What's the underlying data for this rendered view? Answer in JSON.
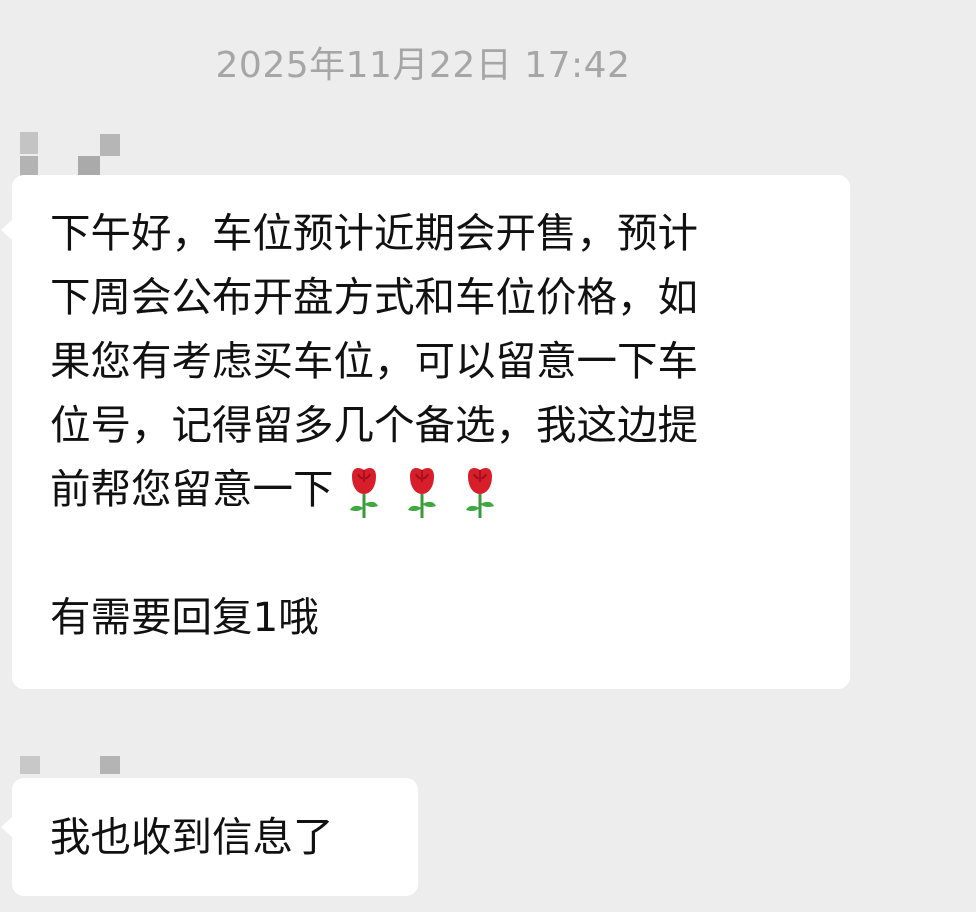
{
  "chat": {
    "timestamp": "2025年11月22日 17:42",
    "messages": [
      {
        "lines": [
          "下午好，车位预计近期会开售，预计",
          "下周会公布开盘方式和车位价格，如",
          "果您有考虑买车位，可以留意一下车",
          "位号，记得留多几个备选，我这边提",
          "前帮您留意一下"
        ],
        "emoji_icons": [
          "rose-icon",
          "rose-icon",
          "rose-icon"
        ],
        "followup": "有需要回复1哦"
      },
      {
        "text": "我也收到信息了"
      }
    ]
  },
  "colors": {
    "background": "#ededed",
    "bubble": "#ffffff",
    "text": "#111111",
    "timestamp": "#a6a6a6",
    "rose_petal": "#d81e2b",
    "rose_stem": "#3a9a3a"
  }
}
